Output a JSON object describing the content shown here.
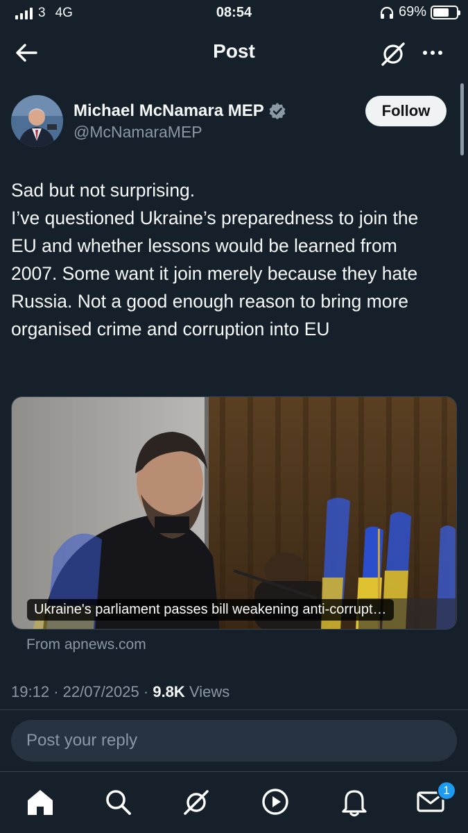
{
  "status_bar": {
    "carrier": "3",
    "network": "4G",
    "time": "08:54",
    "battery_pct": "69%",
    "battery_level": 0.69
  },
  "header": {
    "title": "Post"
  },
  "author": {
    "name": "Michael McNamara MEP",
    "handle": "@McNamaraMEP",
    "verified": true,
    "follow_label": "Follow"
  },
  "tweet": {
    "text": "Sad but not surprising.\nI’ve questioned Ukraine’s preparedness to join the EU and whether lessons would be learned from 2007.  Some want it join merely because they hate Russia. Not a good enough reason to bring more organised crime and corruption into EU"
  },
  "link_card": {
    "caption": "Ukraine's parliament passes bill weakening anti-corrupt…",
    "source": "From apnews.com"
  },
  "meta": {
    "time": "19:12",
    "date": "22/07/2025",
    "views_count": "9.8K",
    "views_label": "Views",
    "separator": "·"
  },
  "reply": {
    "placeholder": "Post your reply"
  },
  "nav": {
    "items": [
      "home-icon",
      "search-icon",
      "grok-icon",
      "video-icon",
      "notifications-icon",
      "messages-icon"
    ],
    "messages_badge": "1"
  },
  "colors": {
    "background": "#15202b",
    "accent": "#1d9bf0",
    "secondary_text": "#8b98a5"
  }
}
